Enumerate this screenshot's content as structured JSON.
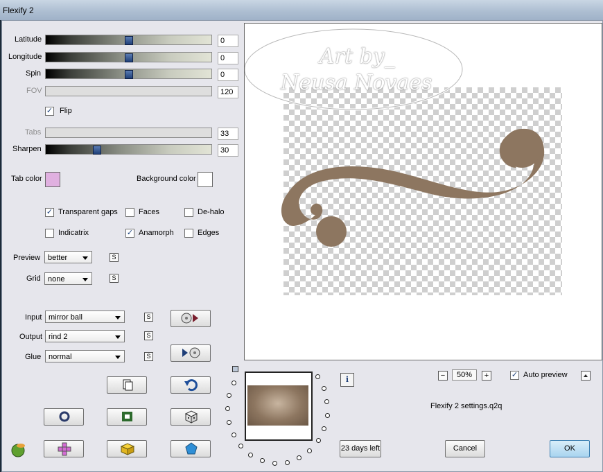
{
  "window": {
    "title": "Flexify 2"
  },
  "sliders": [
    {
      "label": "Latitude",
      "value": "0",
      "enabled": true,
      "level": 0.5
    },
    {
      "label": "Longitude",
      "value": "0",
      "enabled": true,
      "level": 0.5
    },
    {
      "label": "Spin",
      "value": "0",
      "enabled": true,
      "level": 0.5
    },
    {
      "label": "FOV",
      "value": "120",
      "enabled": false
    },
    {
      "label": "Tabs",
      "value": "33",
      "enabled": false
    },
    {
      "label": "Sharpen",
      "value": "30",
      "enabled": true,
      "level": 0.3
    }
  ],
  "flip": {
    "label": "Flip",
    "checked": true
  },
  "colors": {
    "tab_label": "Tab color",
    "tab_color": "#e0b0e0",
    "background_label": "Background color",
    "background_color": "#ffffff",
    "shape_color": "#8d7660",
    "ok_button_color": "#a9d4ef"
  },
  "options": [
    {
      "label": "Transparent gaps",
      "checked": true
    },
    {
      "label": "Faces",
      "checked": false
    },
    {
      "label": "De-halo",
      "checked": false
    },
    {
      "label": "Indicatrix",
      "checked": false
    },
    {
      "label": "Anamorph",
      "checked": true
    },
    {
      "label": "Edges",
      "checked": false
    }
  ],
  "preview_quality": {
    "label": "Preview",
    "value": "better"
  },
  "grid": {
    "label": "Grid",
    "value": "none"
  },
  "mapping": [
    {
      "label": "Input",
      "value": "mirror ball"
    },
    {
      "label": "Output",
      "value": "rind 2"
    },
    {
      "label": "Glue",
      "value": "normal"
    }
  ],
  "s_button_label": "S",
  "check_mark": "✓",
  "watermark": {
    "line1": "Art by_",
    "line2": "Neusa Novaes"
  },
  "zoom": {
    "value": "50%",
    "minus": "−",
    "plus": "+"
  },
  "auto_preview": {
    "label": "Auto preview",
    "checked": true
  },
  "info_icon_text": "i",
  "settings_file": "Flexify 2 settings.q2q",
  "trial": "23 days left",
  "buttons": {
    "cancel": "Cancel",
    "ok": "OK"
  },
  "icons": [
    "dice-icon",
    "copy-icon",
    "undo-icon",
    "ring-icon",
    "square-frame-icon",
    "plus-icon",
    "cube-icon",
    "pentagon-icon",
    "app-logo-icon",
    "swap-to-icon",
    "swap-from-icon",
    "info-icon",
    "collapse-icon"
  ]
}
